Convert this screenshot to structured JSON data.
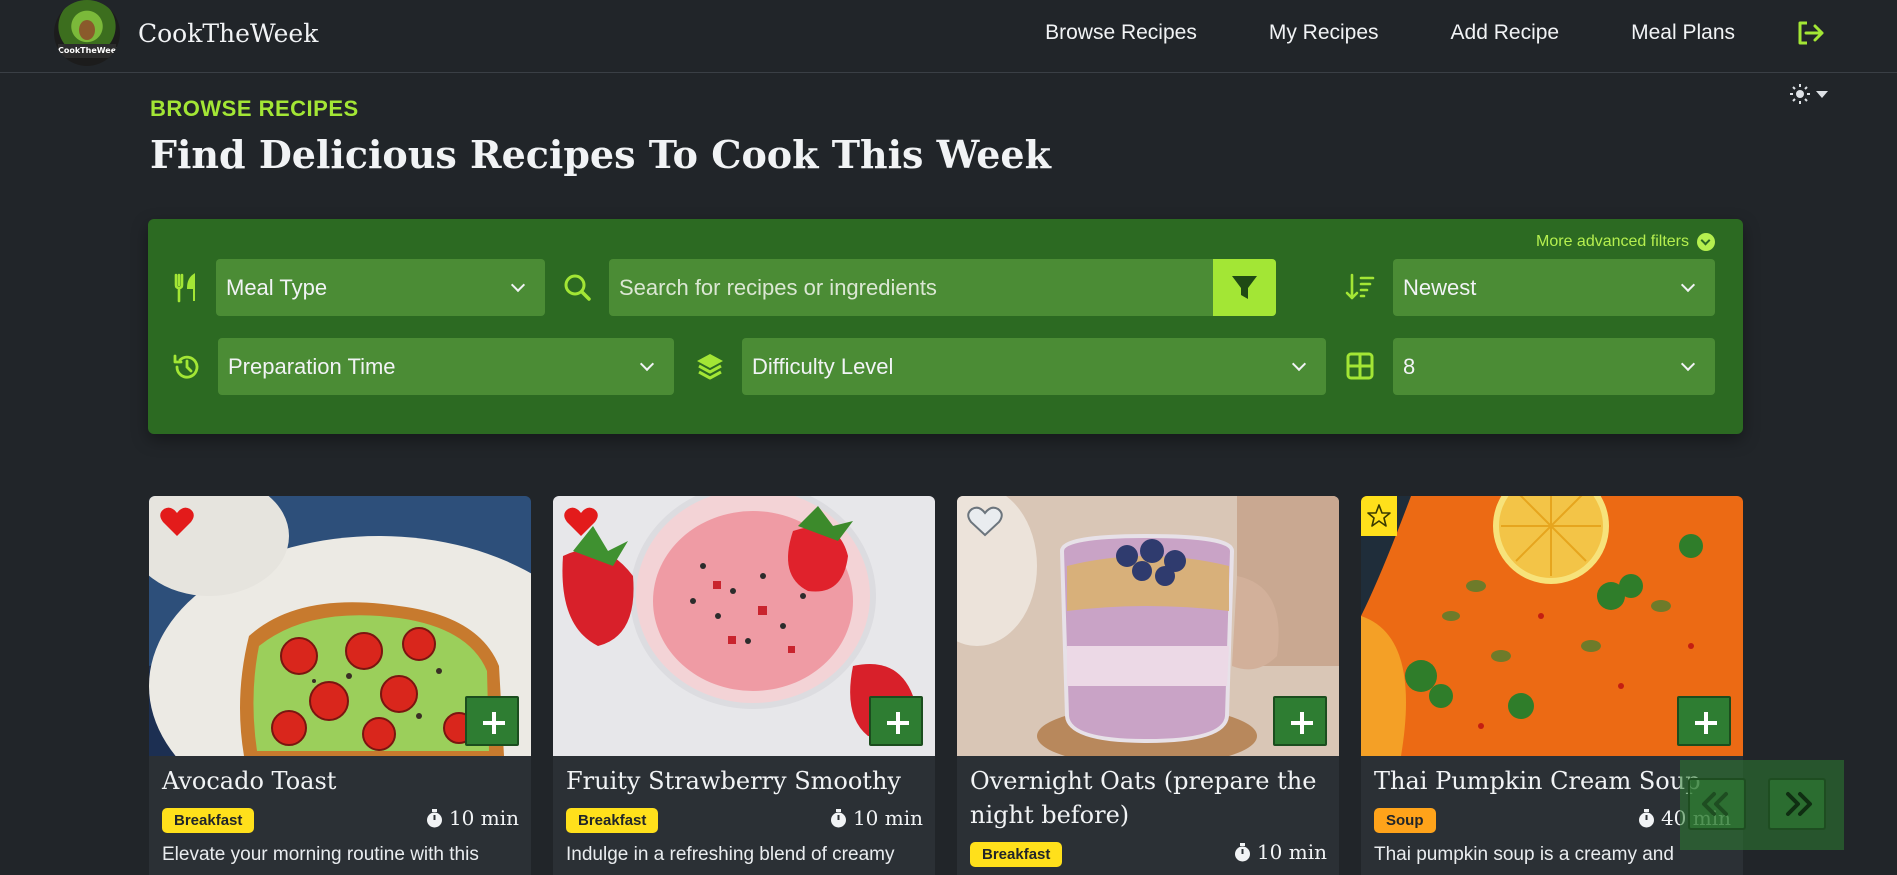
{
  "brand": {
    "name": "CookTheWeek",
    "logo_text": "CookTheWeek"
  },
  "nav": {
    "items": [
      "Browse Recipes",
      "My Recipes",
      "Add Recipe",
      "Meal Plans"
    ],
    "logout_icon": "logout-icon"
  },
  "theme": {
    "icon": "sun-icon"
  },
  "header": {
    "eyebrow": "BROWSE RECIPES",
    "title": "Find Delicious Recipes To Cook This Week"
  },
  "filters": {
    "advanced_label": "More advanced filters",
    "meal_type": "Meal Type",
    "search_placeholder": "Search for recipes or ingredients",
    "sort": "Newest",
    "prep_time": "Preparation Time",
    "difficulty": "Difficulty Level",
    "per_page": "8"
  },
  "recipes": [
    {
      "title": "Avocado Toast",
      "category": "Breakfast",
      "time": "10 min",
      "desc": "Elevate your morning routine with this",
      "favorite": "filled"
    },
    {
      "title": "Fruity Strawberry Smoothy",
      "category": "Breakfast",
      "time": "10 min",
      "desc": "Indulge in a refreshing blend of creamy",
      "favorite": "filled"
    },
    {
      "title": "Overnight Oats (prepare the night before)",
      "category": "Breakfast",
      "time": "10 min",
      "desc": "",
      "favorite": "outline"
    },
    {
      "title": "Thai Pumpkin Cream Soup",
      "category": "Soup",
      "time": "40 min",
      "desc": "Thai pumpkin soup is a creamy and",
      "favorite": "star"
    }
  ],
  "colors": {
    "accent": "#a3e635",
    "panel": "#2c6a22",
    "field": "#4b8c35",
    "background": "#212529"
  }
}
